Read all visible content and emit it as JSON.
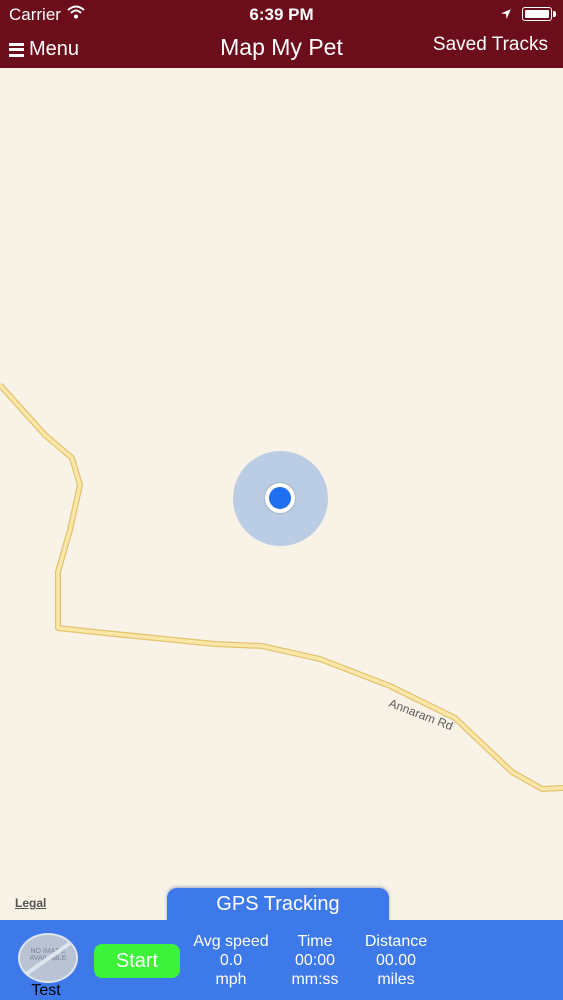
{
  "status_bar": {
    "carrier": "Carrier",
    "time": "6:39 PM"
  },
  "nav": {
    "menu_label": "Menu",
    "title": "Map My Pet",
    "saved_tracks_label": "Saved Tracks"
  },
  "map": {
    "road_label": "Annaram Rd",
    "legal_label": "Legal"
  },
  "gps_tab_label": "GPS Tracking",
  "panel": {
    "pet_name": "Test",
    "no_image_text": "NO IMAGE AVAILABLE",
    "start_label": "Start",
    "avg_speed": {
      "label": "Avg speed",
      "value": "0.0",
      "unit": "mph"
    },
    "time": {
      "label": "Time",
      "value": "00:00",
      "unit": "mm:ss"
    },
    "distance": {
      "label": "Distance",
      "value": "00.00",
      "unit": "miles"
    }
  },
  "colors": {
    "nav_bar": "#6b0d1b",
    "panel": "#3e79ea",
    "start_button": "#3cf33a",
    "map_bg": "#f9f2e7",
    "road": "#f3d57a",
    "user_dot": "#1f6ff0"
  },
  "icons": [
    "wifi-icon",
    "location-arrow-icon",
    "battery-icon",
    "hamburger-icon",
    "no-image-icon"
  ]
}
